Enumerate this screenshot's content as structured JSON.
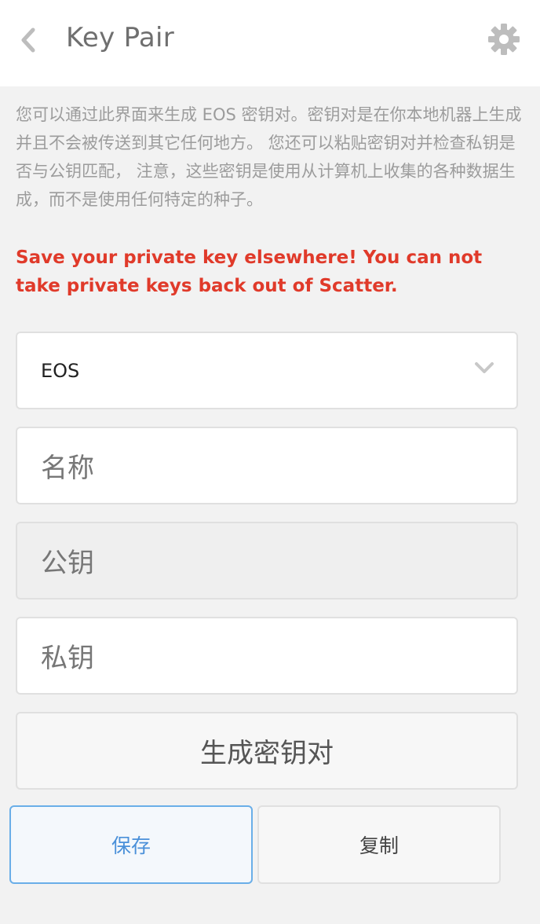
{
  "header": {
    "title": "Key Pair",
    "back_icon": "chevron-left-icon",
    "settings_icon": "gear-icon"
  },
  "description": "您可以通过此界面来生成 EOS 密钥对。密钥对是在你本地机器上生成并且不会被传送到其它任何地方。 您还可以粘贴密钥对并检查私钥是否与公钥匹配， 注意，这些密钥是使用从计算机上收集的各种数据生成，而不是使用任何特定的种子。",
  "warning": "Save your private key elsewhere! You can not take private keys back out of Scatter.",
  "blockchain_select": {
    "value": "EOS",
    "icon": "chevron-down-icon"
  },
  "fields": {
    "name_placeholder": "名称",
    "public_key_placeholder": "公钥",
    "private_key_placeholder": "私钥"
  },
  "buttons": {
    "generate": "生成密钥对",
    "save": "保存",
    "copy": "复制"
  },
  "colors": {
    "warning": "#e03a2a",
    "accent": "#4a90d9",
    "description": "#9c9c9c"
  }
}
